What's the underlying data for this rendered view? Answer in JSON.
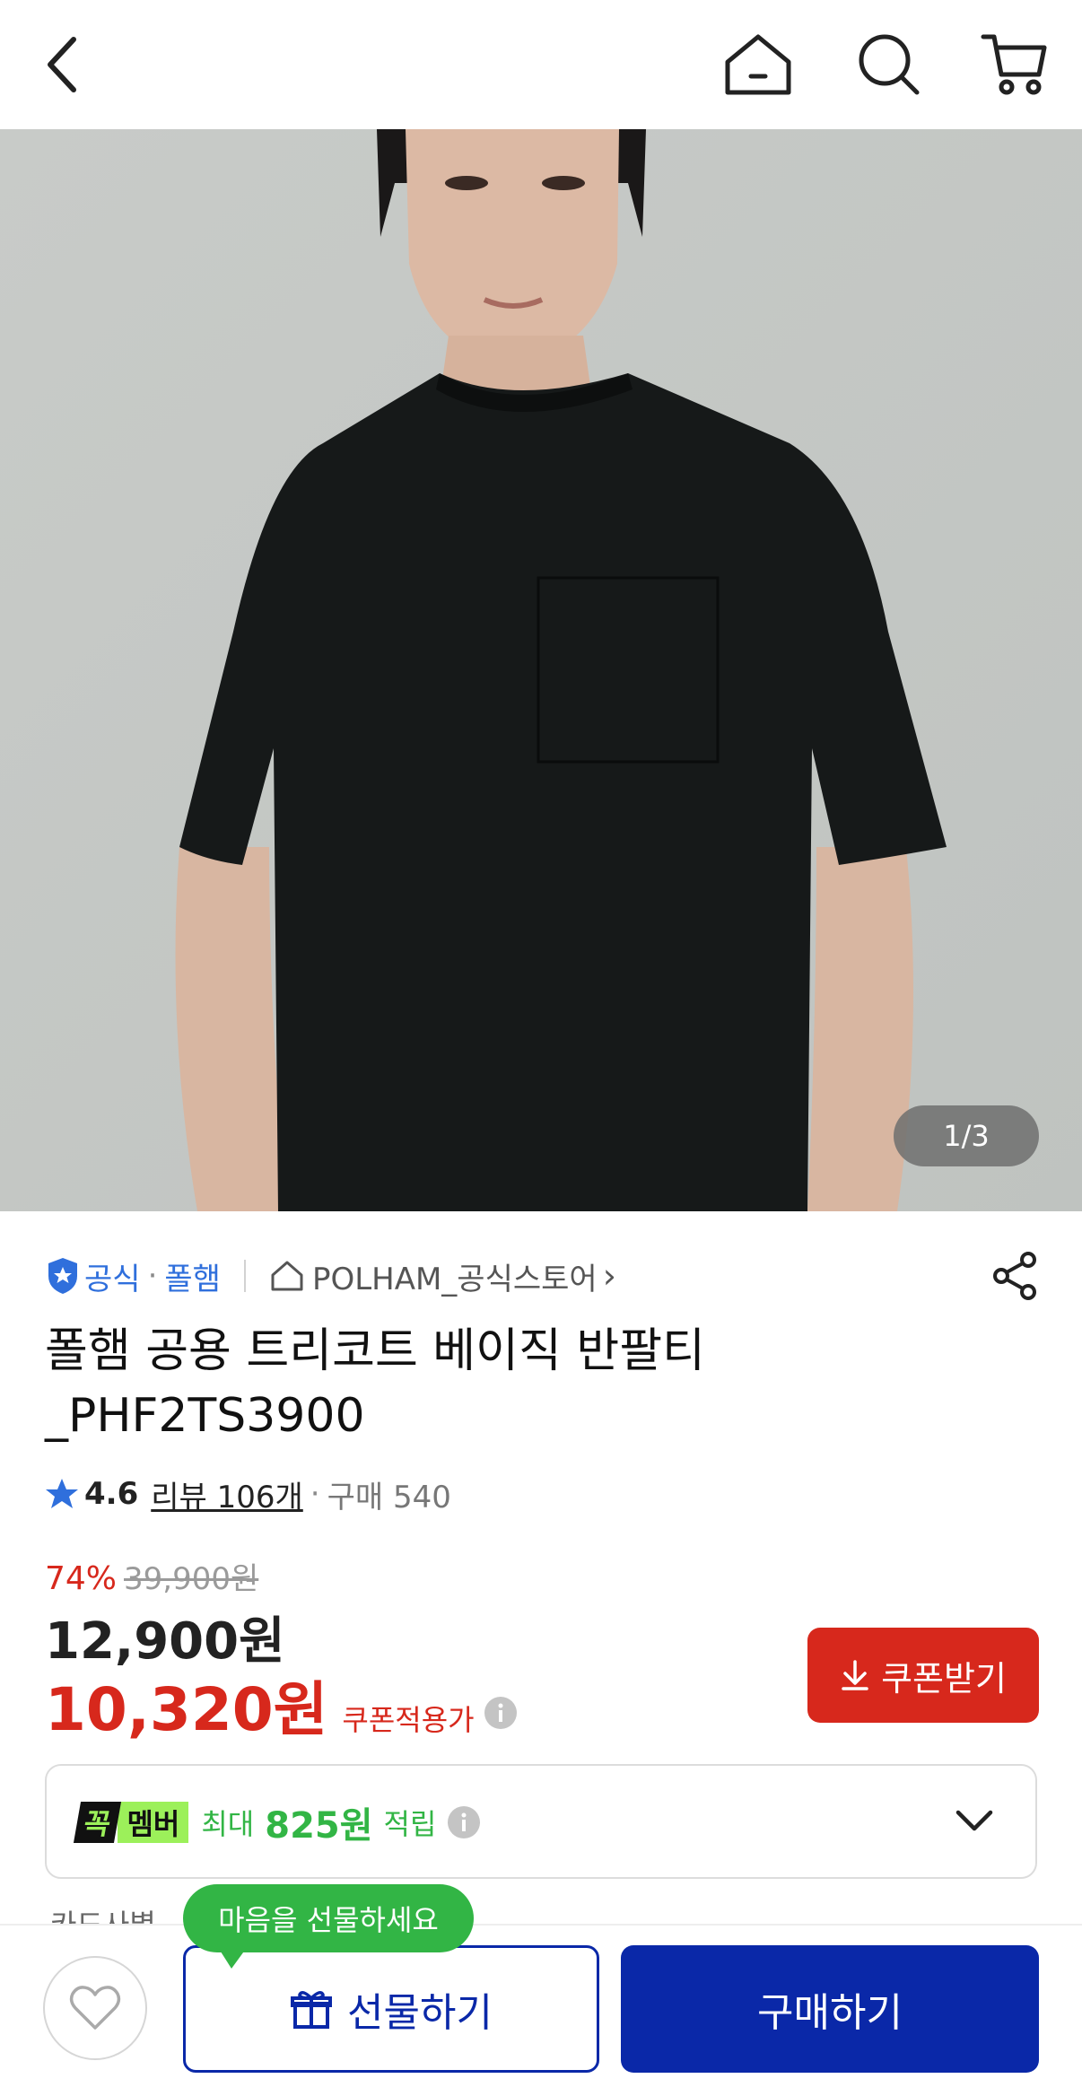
{
  "colors": {
    "brand_blue": "#0a28a8",
    "sale_red": "#d7281c",
    "member_green": "#32b545",
    "link_blue": "#2f6fdc"
  },
  "hero": {
    "page_indicator": "1/3"
  },
  "seller": {
    "official_label": "공식",
    "separator": "·",
    "brand": "폴햄",
    "store_name": "POLHAM_공식스토어",
    "store_chevron": "›"
  },
  "product": {
    "title_line1": "폴햄 공용 트리코트 베이직 반팔티",
    "title_line2": "_PHF2TS3900"
  },
  "rating": {
    "score": "4.6",
    "reviews": "리뷰 106개",
    "separator": "·",
    "purchases": "구매 540"
  },
  "pricing": {
    "discount": "74%",
    "original_price": "39,900원",
    "price": "12,900원",
    "coupon_price": "10,320원",
    "coupon_label": "쿠폰적용가",
    "coupon_button": "쿠폰받기"
  },
  "member": {
    "badge_part1": "꼭",
    "badge_part2": "멤버",
    "prefix": "최대",
    "points": "825원",
    "suffix": "적립"
  },
  "card_row": {
    "text": "카드사별"
  },
  "bottom": {
    "tooltip": "마음을 선물하세요",
    "gift_button": "선물하기",
    "buy_button": "구매하기"
  }
}
